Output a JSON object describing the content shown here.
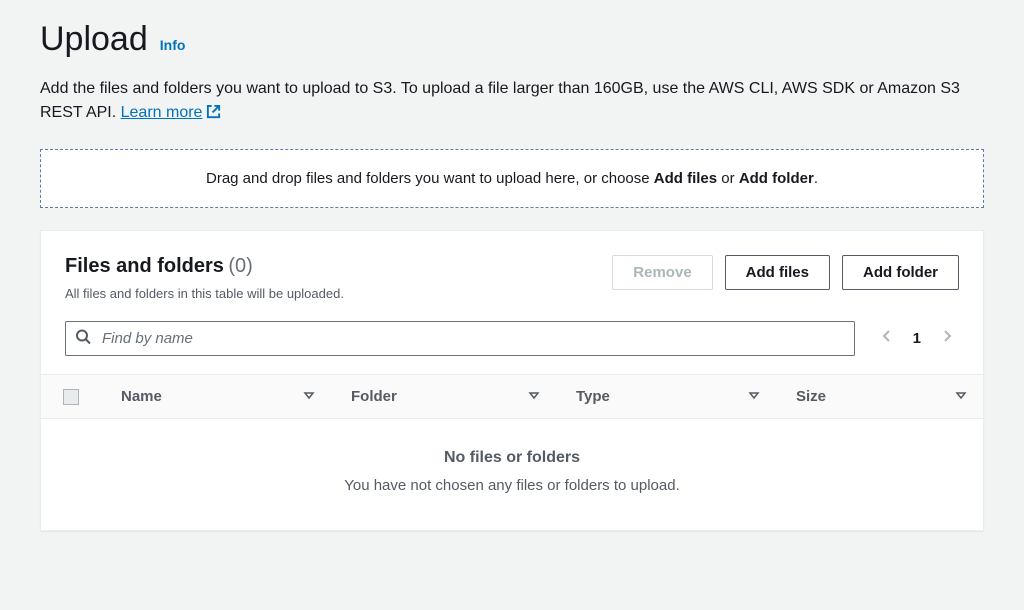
{
  "header": {
    "title": "Upload",
    "info": "Info"
  },
  "description": {
    "text": "Add the files and folders you want to upload to S3. To upload a file larger than 160GB, use the AWS CLI, AWS SDK or Amazon S3 REST API. ",
    "learn_more": "Learn more"
  },
  "dropzone": {
    "prefix": "Drag and drop files and folders you want to upload here, or choose ",
    "add_files": "Add files",
    "or": " or ",
    "add_folder": "Add folder",
    "suffix": "."
  },
  "panel": {
    "title": "Files and folders",
    "count": "(0)",
    "subtitle": "All files and folders in this table will be uploaded.",
    "buttons": {
      "remove": "Remove",
      "add_files": "Add files",
      "add_folder": "Add folder"
    },
    "search_placeholder": "Find by name",
    "page_num": "1",
    "columns": {
      "name": "Name",
      "folder": "Folder",
      "type": "Type",
      "size": "Size"
    },
    "empty": {
      "title": "No files or folders",
      "subtitle": "You have not chosen any files or folders to upload."
    }
  }
}
